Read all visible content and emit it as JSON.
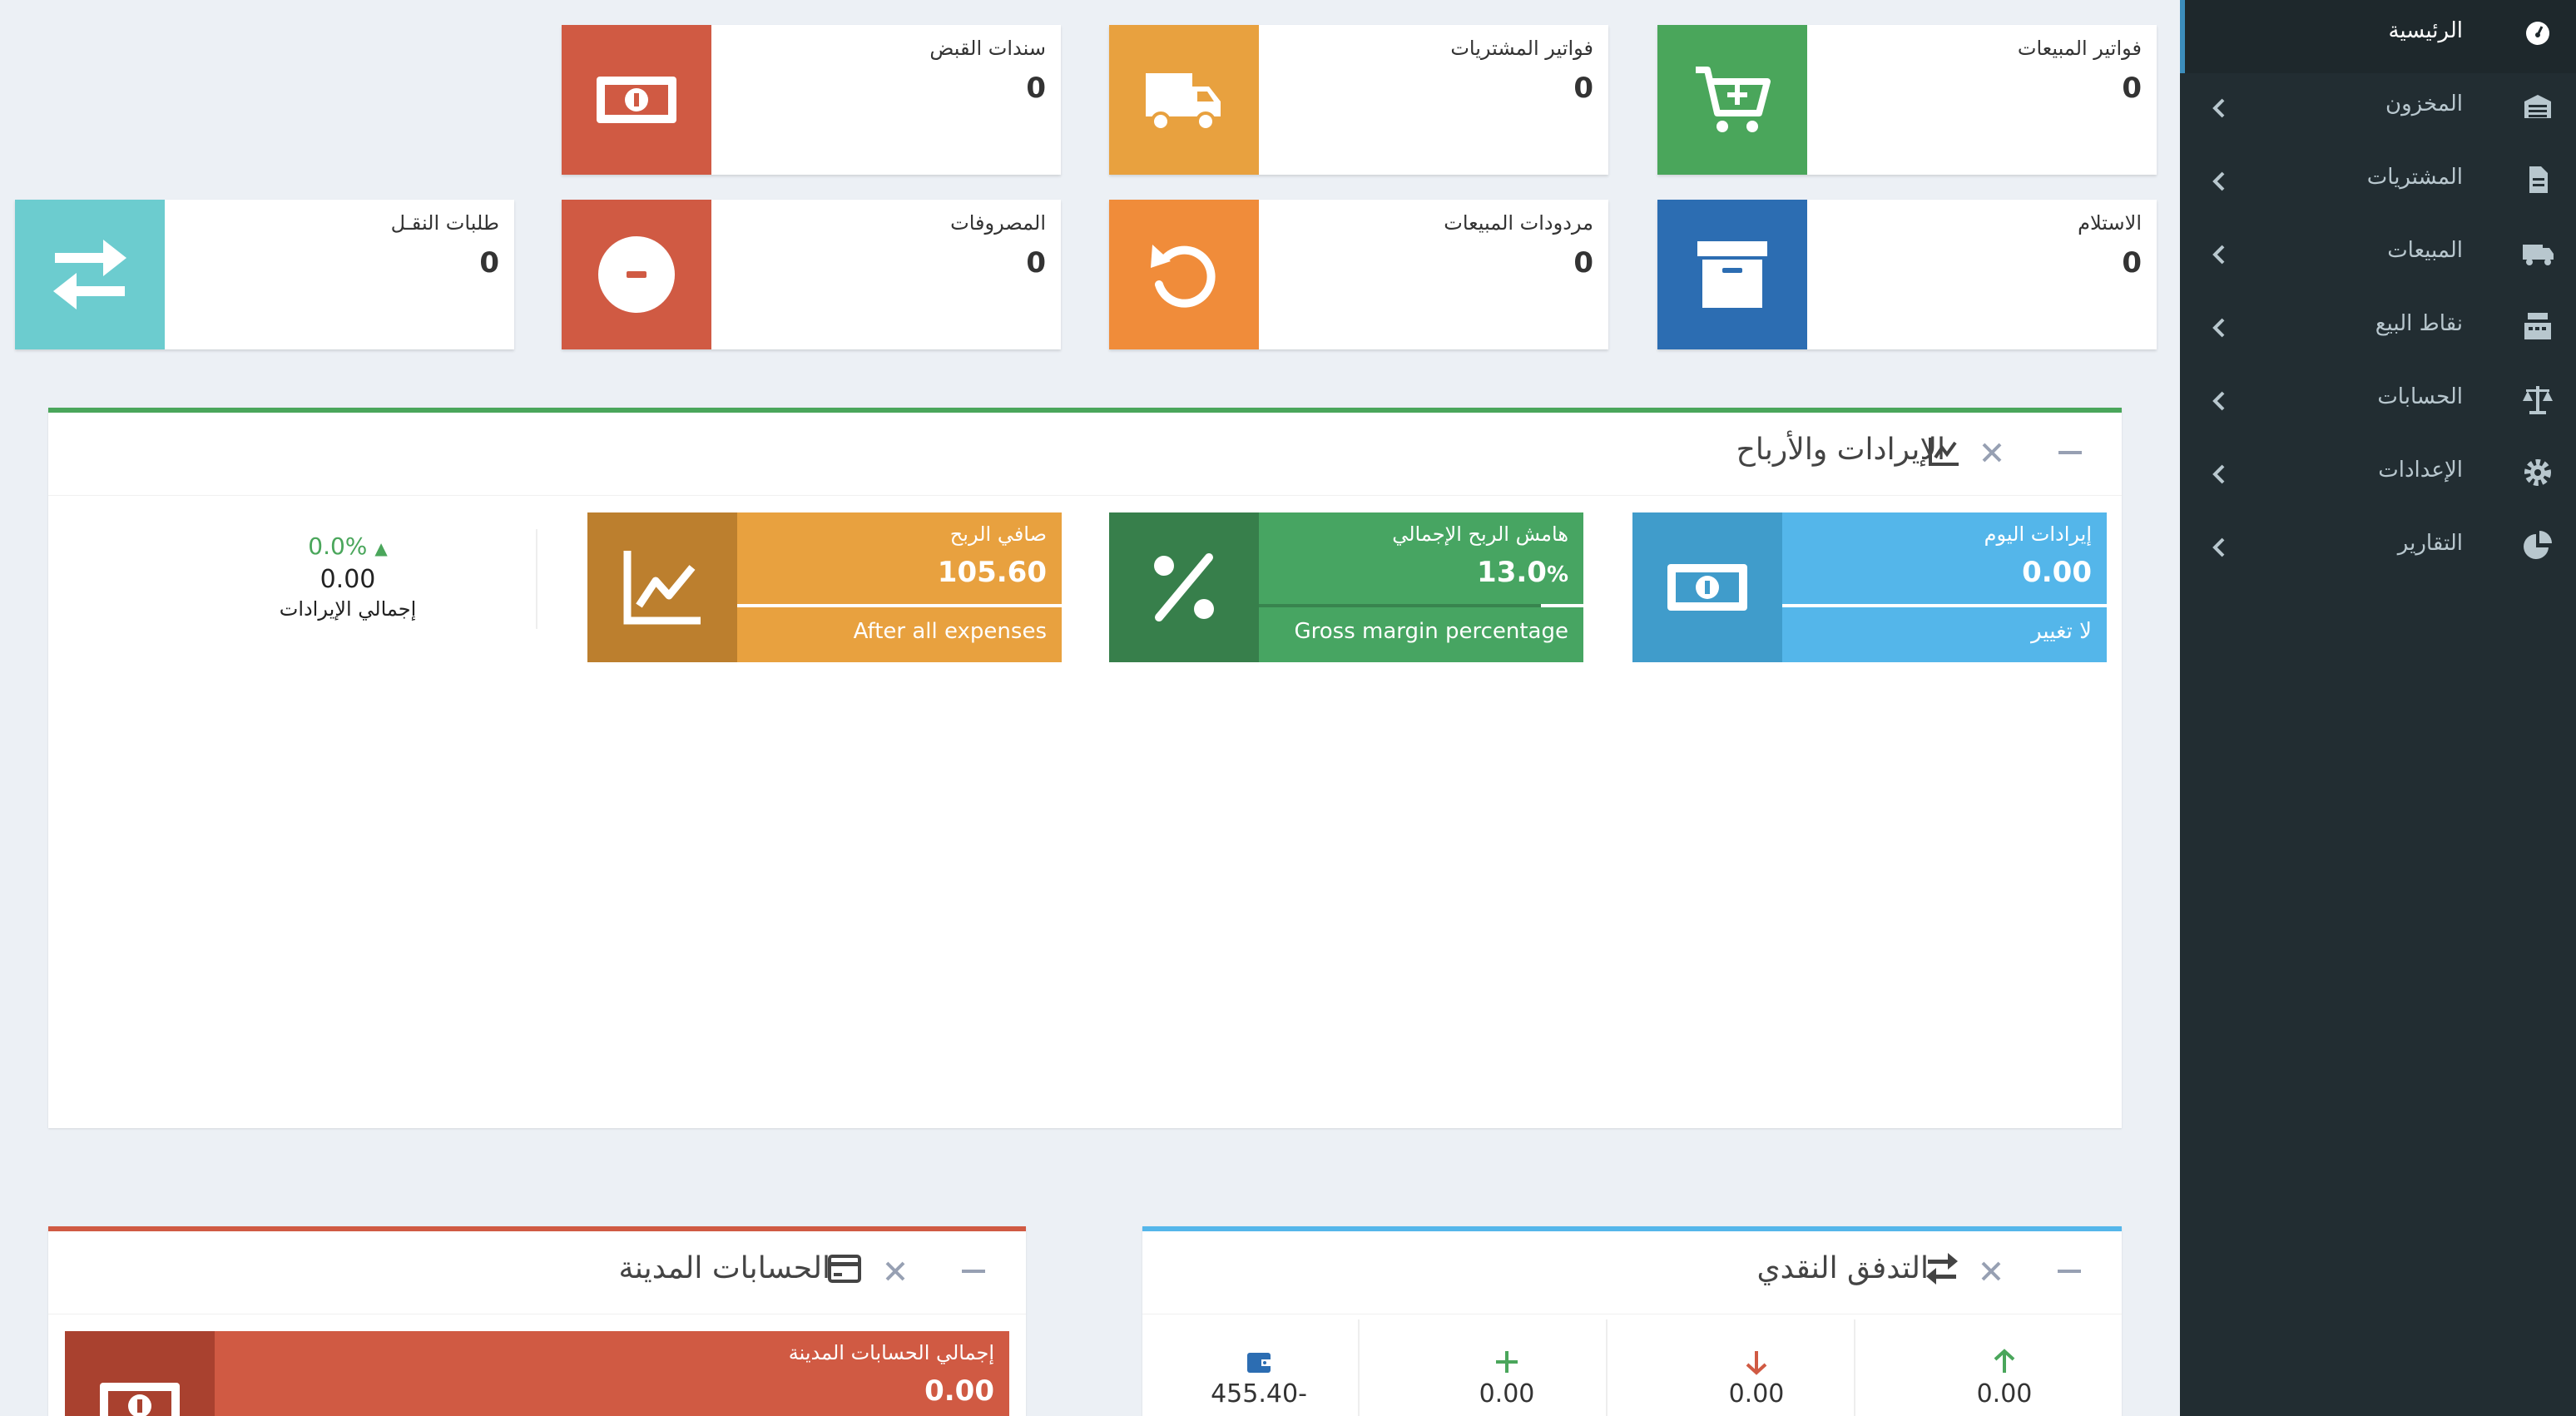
{
  "sidebar": {
    "items": [
      {
        "label": "الرئيسية",
        "icon": "dashboard-icon",
        "active": true
      },
      {
        "label": "المخزون",
        "icon": "warehouse-icon"
      },
      {
        "label": "المشتريات",
        "icon": "file-invoice-icon"
      },
      {
        "label": "المبيعات",
        "icon": "truck-icon"
      },
      {
        "label": "نقاط البيع",
        "icon": "cash-register-icon"
      },
      {
        "label": "الحسابات",
        "icon": "balance-scale-icon"
      },
      {
        "label": "الإعدادات",
        "icon": "cog-icon"
      },
      {
        "label": "التقارير",
        "icon": "pie-chart-icon"
      }
    ]
  },
  "info_boxes": [
    {
      "title": "فواتير المبيعات",
      "value": "0",
      "icon": "cart-plus-icon",
      "color": "#4aa65b"
    },
    {
      "title": "فواتير المشتريات",
      "value": "0",
      "icon": "truck-icon",
      "color": "#e8a13f"
    },
    {
      "title": "سندات القبض",
      "value": "0",
      "icon": "money-bill-icon",
      "color": "#d05a43"
    },
    {
      "title": "الاستلام",
      "value": "0",
      "icon": "archive-icon",
      "color": "#2c6db2"
    },
    {
      "title": "مردودات المبيعات",
      "value": "0",
      "icon": "undo-icon",
      "color": "#f08c3a"
    },
    {
      "title": "المصروفات",
      "value": "0",
      "icon": "minus-circle-icon",
      "color": "#d05a43"
    },
    {
      "title": "طلبات النقـل",
      "value": "0",
      "icon": "exchange-icon",
      "color": "#6ccccf"
    }
  ],
  "revenue_panel": {
    "title": "الإيرادات والأرباح",
    "accent": "#4aa65b",
    "boxes": [
      {
        "label": "إيرادات اليوم",
        "value": "0.00",
        "desc": "لا تغيير",
        "progress": 1.0,
        "color": "#54b6ea",
        "icon_color": "#409ccb",
        "icon": "money-bill-icon"
      },
      {
        "label": "هامش الربح الإجمالي",
        "value": "13.0",
        "value_unit": "%",
        "desc": "Gross margin percentage",
        "progress": 0.13,
        "color": "#47a562",
        "icon_color": "#377f4b",
        "icon": "percent-icon"
      },
      {
        "label": "صافي الربح",
        "value": "105.60",
        "desc": "After all expenses",
        "progress": 1.0,
        "color": "#e8a13f",
        "icon_color": "#bc7f2e",
        "icon": "line-chart-icon"
      }
    ],
    "summary": {
      "change": "0.0%",
      "value": "0.00",
      "label": "إجمالي الإيرادات"
    }
  },
  "cashflow_panel": {
    "title": "التدفق النقدي",
    "accent": "#54b6ea",
    "columns": [
      {
        "value": "0.00",
        "icon": "arrow-up-icon",
        "color": "#4aa65b"
      },
      {
        "value": "0.00",
        "icon": "arrow-down-icon",
        "color": "#d05a43"
      },
      {
        "value": "0.00",
        "icon": "plus-icon",
        "color": "#4aa65b"
      },
      {
        "value": "455.40-",
        "icon": "wallet-icon",
        "color": "#2c6db2"
      }
    ]
  },
  "receivables_panel": {
    "title": "الحسابات المدينة",
    "accent": "#d05a43",
    "box": {
      "label": "إجمالي الحسابات المدينة",
      "value": "0.00",
      "color": "#d05a43",
      "icon_color": "#a9412f",
      "icon": "money-bill-icon"
    }
  }
}
